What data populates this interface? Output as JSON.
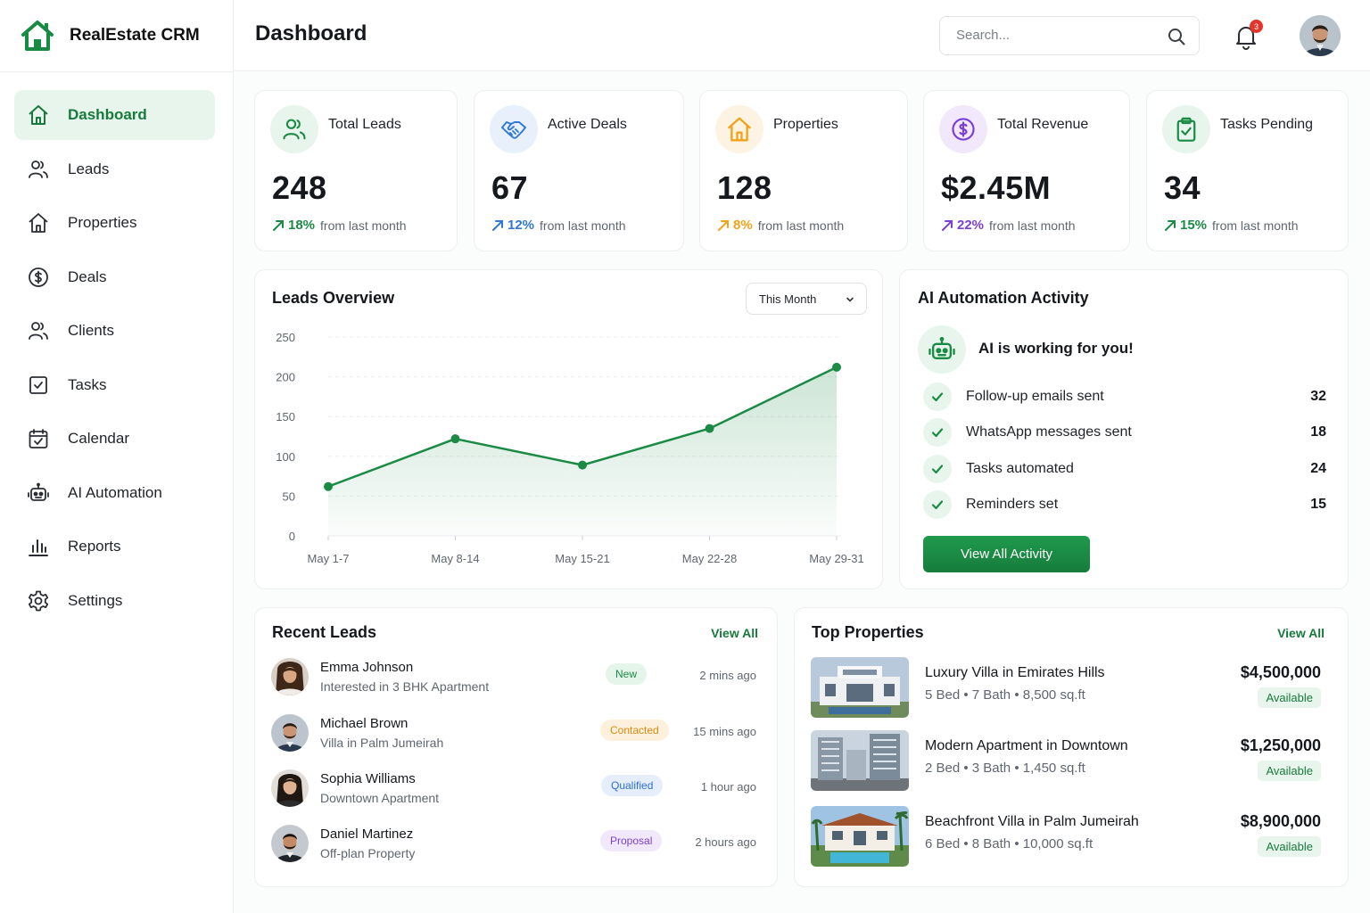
{
  "app": {
    "name": "RealEstate CRM"
  },
  "header": {
    "title": "Dashboard",
    "search_placeholder": "Search...",
    "notification_count": "3"
  },
  "sidebar": {
    "items": [
      {
        "label": "Dashboard",
        "icon": "home-icon"
      },
      {
        "label": "Leads",
        "icon": "users-icon"
      },
      {
        "label": "Properties",
        "icon": "house-icon"
      },
      {
        "label": "Deals",
        "icon": "dollar-icon"
      },
      {
        "label": "Clients",
        "icon": "users-icon"
      },
      {
        "label": "Tasks",
        "icon": "checkbox-icon"
      },
      {
        "label": "Calendar",
        "icon": "calendar-icon"
      },
      {
        "label": "AI Automation",
        "icon": "robot-icon"
      },
      {
        "label": "Reports",
        "icon": "bar-chart-icon"
      },
      {
        "label": "Settings",
        "icon": "gear-icon"
      }
    ]
  },
  "stats": [
    {
      "title": "Total Leads",
      "value": "248",
      "pct": "18%",
      "suffix": "from last month",
      "color": "#1a8a45",
      "icon": "users-icon"
    },
    {
      "title": "Active Deals",
      "value": "67",
      "pct": "12%",
      "suffix": "from last month",
      "color": "#2f78d6",
      "icon": "handshake-icon"
    },
    {
      "title": "Properties",
      "value": "128",
      "pct": "8%",
      "suffix": "from last month",
      "color": "#f2a21a",
      "icon": "house-icon"
    },
    {
      "title": "Total Revenue",
      "value": "$2.45M",
      "pct": "22%",
      "suffix": "from last month",
      "color": "#7b3fd6",
      "icon": "dollar-icon"
    },
    {
      "title": "Tasks Pending",
      "value": "34",
      "pct": "15%",
      "suffix": "from last month",
      "color": "#1a8a45",
      "icon": "clipboard-check-icon"
    }
  ],
  "leads_overview": {
    "title": "Leads Overview",
    "range": "This Month",
    "y_ticks": [
      "250",
      "200",
      "150",
      "100",
      "50",
      "0"
    ]
  },
  "chart_data": {
    "type": "area",
    "categories": [
      "May 1-7",
      "May 8-14",
      "May 15-21",
      "May 22-28",
      "May 29-31"
    ],
    "values": [
      62,
      122,
      89,
      135,
      212
    ],
    "ylim": [
      0,
      250
    ],
    "grid": true,
    "color": "#1a8a45"
  },
  "ai": {
    "title": "AI Automation Activity",
    "headline": "AI is working for you!",
    "items": [
      {
        "label": "Follow-up emails sent",
        "count": "32"
      },
      {
        "label": "WhatsApp messages sent",
        "count": "18"
      },
      {
        "label": "Tasks automated",
        "count": "24"
      },
      {
        "label": "Reminders set",
        "count": "15"
      }
    ],
    "button": "View All Activity"
  },
  "recent_leads": {
    "title": "Recent Leads",
    "view_all": "View All",
    "rows": [
      {
        "name": "Emma Johnson",
        "sub": "Interested in 3 BHK Apartment",
        "tag": "New",
        "time": "2 mins ago"
      },
      {
        "name": "Michael Brown",
        "sub": "Villa in Palm Jumeirah",
        "tag": "Contacted",
        "time": "15 mins ago"
      },
      {
        "name": "Sophia Williams",
        "sub": "Downtown Apartment",
        "tag": "Qualified",
        "time": "1 hour ago"
      },
      {
        "name": "Daniel Martinez",
        "sub": "Off-plan Property",
        "tag": "Proposal",
        "time": "2 hours ago"
      }
    ]
  },
  "top_properties": {
    "title": "Top Properties",
    "view_all": "View All",
    "rows": [
      {
        "name": "Luxury Villa in Emirates Hills",
        "details": "5 Bed  •  7 Bath  •  8,500 sq.ft",
        "price": "$4,500,000",
        "status": "Available"
      },
      {
        "name": "Modern Apartment in Downtown",
        "details": "2 Bed  •  3 Bath  •  1,450 sq.ft",
        "price": "$1,250,000",
        "status": "Available"
      },
      {
        "name": "Beachfront Villa in Palm Jumeirah",
        "details": "6 Bed  •  8 Bath  •  10,000 sq.ft",
        "price": "$8,900,000",
        "status": "Available"
      }
    ]
  }
}
